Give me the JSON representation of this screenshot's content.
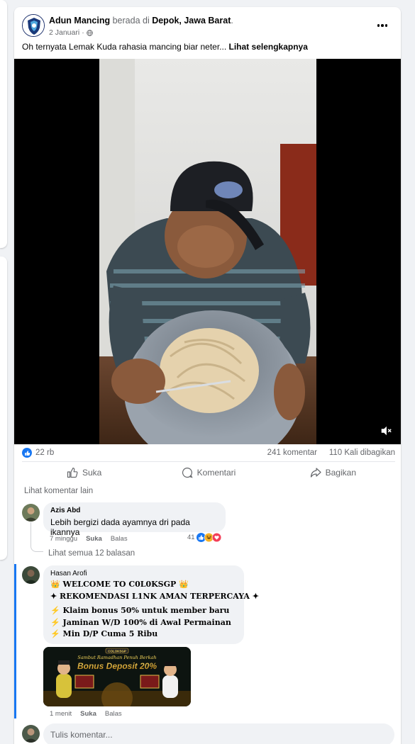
{
  "post": {
    "author": "Adun Mancing",
    "at_text": "berada di",
    "location": "Depok, Jawa Barat",
    "location_suffix": ".",
    "date": "2 Januari",
    "privacy_icon": "globe-icon",
    "caption_text": "Oh ternyata Lemak Kuda rahasia mancing biar neter...",
    "caption_more": "Lihat selengkapnya"
  },
  "video": {
    "muted_icon": "volume-muted-icon"
  },
  "stats": {
    "reactions": "22 rb",
    "comments": "241 komentar",
    "shares": "110 Kali dibagikan"
  },
  "actions": {
    "like": "Suka",
    "comment": "Komentari",
    "share": "Bagikan"
  },
  "comments_section": {
    "view_more": "Lihat komentar lain",
    "comments": [
      {
        "name": "Azis Abd",
        "text": "Lebih bergizi dada ayamnya dri pada ikannya",
        "time": "7 minggu",
        "like": "Suka",
        "reply": "Balas",
        "reaction_count": "41",
        "view_replies": "Lihat semua 12 balasan"
      },
      {
        "name": "Hasan Arofi",
        "lines": [
          "👑 WELCOME TO C0L0KSGP 👑",
          "✦ REKOMENDASI L1NK AMAN TERPERCAYA ✦",
          "⚡ Klaim bonus 50% untuk member baru",
          "⚡ Jaminan W/D 100% di Awal Permainan",
          "⚡ Min D/P Cuma 5 Ribu"
        ],
        "image_brand": "COLOKSGP",
        "image_title": "Bonus Deposit 20%",
        "image_subtitle": "Sambut Ramadhan Penuh Berkah",
        "time": "1 menit",
        "like": "Suka",
        "reply": "Balas"
      }
    ],
    "write_placeholder": "Tulis komentar..."
  },
  "colors": {
    "accent": "#1877f2",
    "text_secondary": "#65676b",
    "bubble": "#f0f2f5"
  }
}
